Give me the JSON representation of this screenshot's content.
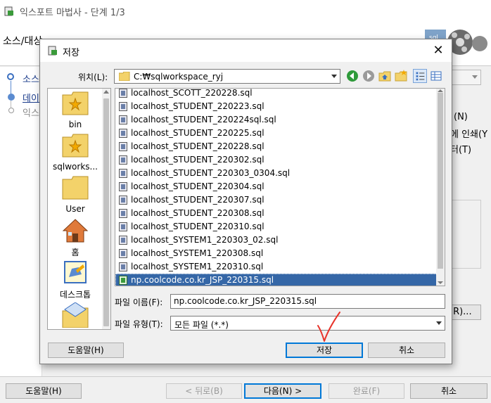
{
  "background_window": {
    "title": "익스포트 마법사 - 단계 1/3",
    "header": "소스/대상",
    "steps": [
      "소스",
      "데이",
      "익스"
    ],
    "right_options": [
      "(N)",
      "에 인쇄(Y",
      "터(T)"
    ],
    "right_button": "(R)...",
    "buttons": {
      "help": "도움말(H)",
      "back": "< 뒤로(B)",
      "next": "다음(N) >",
      "finish": "완료(F)",
      "cancel": "취소"
    }
  },
  "dialog": {
    "title": "저장",
    "location_label": "위치(L):",
    "location_value": "C:₩sqlworkspace_ryj",
    "places": [
      {
        "label": "bin",
        "icon": "star-folder-icon"
      },
      {
        "label": "sqlworks...",
        "icon": "star-folder-icon"
      },
      {
        "label": "User",
        "icon": "folder-icon"
      },
      {
        "label": "홈",
        "icon": "home-icon"
      },
      {
        "label": "데스크톱",
        "icon": "desktop-icon"
      },
      {
        "label": "",
        "icon": "network-folder-icon"
      }
    ],
    "files": [
      "localhost_SCOTT_220228.sql",
      "localhost_STUDENT_220223.sql",
      "localhost_STUDENT_220224sql.sql",
      "localhost_STUDENT_220225.sql",
      "localhost_STUDENT_220228.sql",
      "localhost_STUDENT_220302.sql",
      "localhost_STUDENT_220303_0304.sql",
      "localhost_STUDENT_220304.sql",
      "localhost_STUDENT_220307.sql",
      "localhost_STUDENT_220308.sql",
      "localhost_STUDENT_220310.sql",
      "localhost_SYSTEM1_220303_02.sql",
      "localhost_SYSTEM1_220308.sql",
      "localhost_SYSTEM1_220310.sql",
      "np.coolcode.co.kr_JSP_220315.sql"
    ],
    "selected_file_index": 14,
    "filename_label": "파일 이름(F):",
    "filename_value": "np.coolcode.co.kr_JSP_220315.sql",
    "filetype_label": "파일 유형(T):",
    "filetype_value": "모든 파일 (*.*)",
    "buttons": {
      "help": "도움말(H)",
      "save": "저장",
      "cancel": "취소"
    }
  }
}
